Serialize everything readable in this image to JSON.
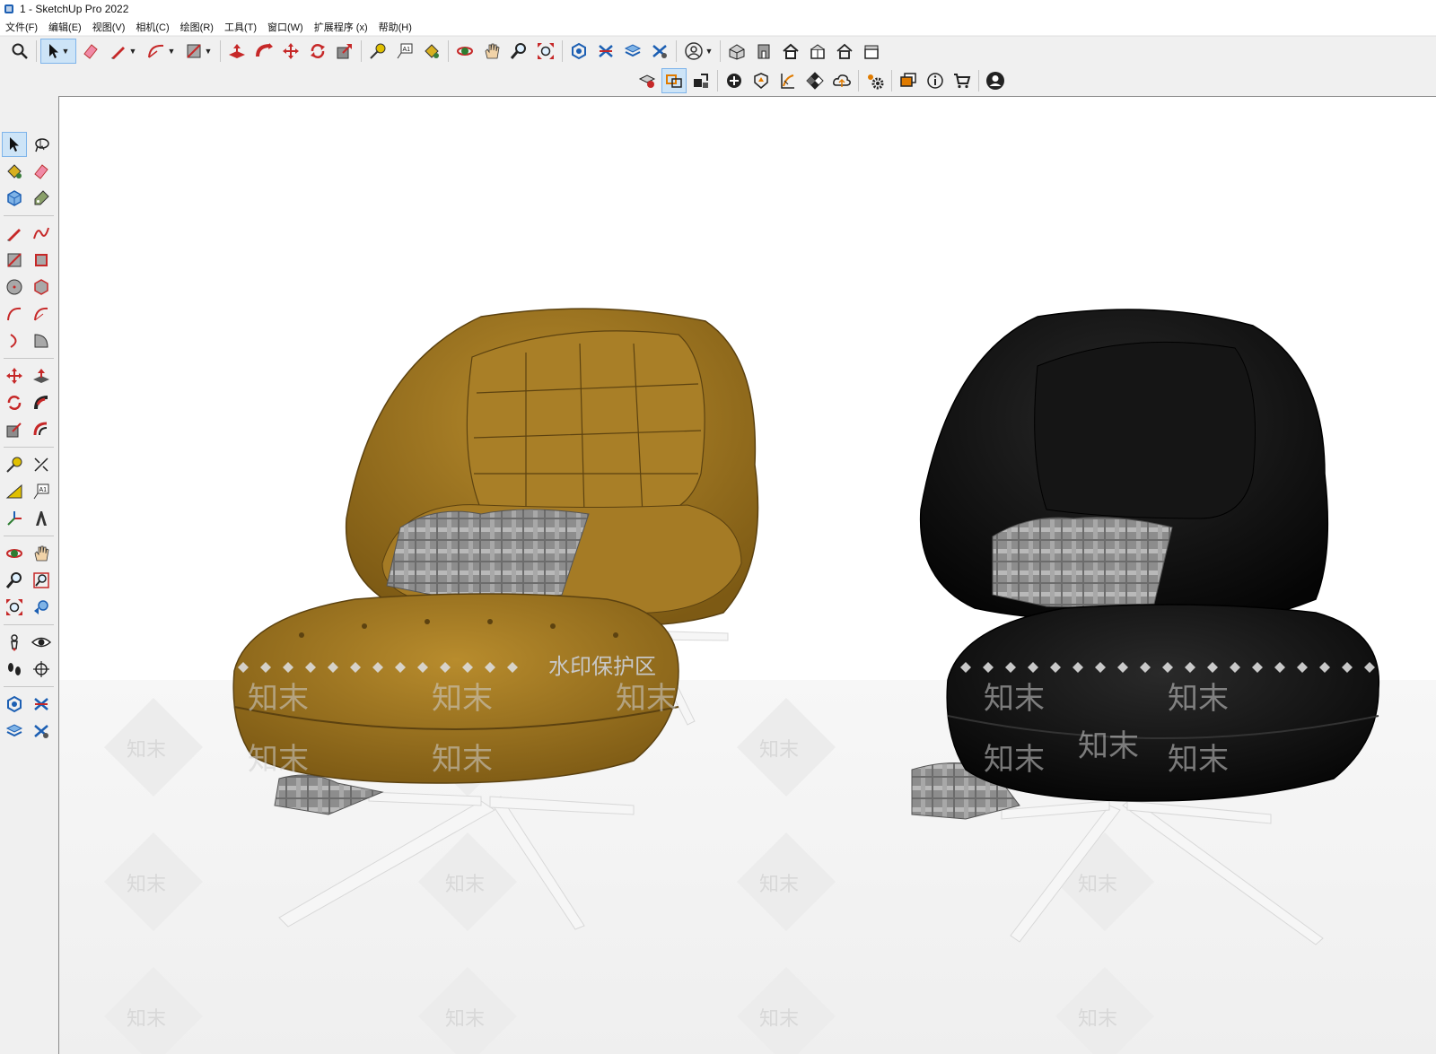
{
  "window": {
    "title": "1 - SketchUp Pro 2022"
  },
  "menu": {
    "items": [
      "文件(F)",
      "编辑(E)",
      "视图(V)",
      "相机(C)",
      "绘图(R)",
      "工具(T)",
      "窗口(W)",
      "扩展程序 (x)",
      "帮助(H)"
    ]
  },
  "watermark": {
    "protect_label": "水印保护区",
    "brand_text": "知末"
  },
  "colors": {
    "accent": "#cde4f7",
    "chair_left": "#a57b25",
    "chair_right": "#1a1a1a",
    "throw": "#8e8e8e",
    "legs": "#f4f4f4"
  },
  "icons": {
    "main_toolbar": [
      "search-icon",
      "select-icon",
      "eraser-icon",
      "pencil-icon",
      "arc-icon",
      "rectangle-icon",
      "push-pull-icon",
      "follow-me-icon",
      "move-icon",
      "rotate-icon",
      "scale-icon",
      "tape-measure-icon",
      "text-icon",
      "paint-bucket-icon",
      "orbit-icon",
      "pan-icon",
      "zoom-icon",
      "zoom-extents-icon",
      "warehouse-icon",
      "extension-warehouse-icon",
      "layout-icon",
      "extension-manager-icon",
      "account-icon",
      "iso-view-icon",
      "front-view-icon",
      "top-view-icon",
      "right-view-icon",
      "back-view-icon",
      "left-view-icon"
    ],
    "secondary_toolbar": [
      "solid-tools-icon",
      "outer-shell-icon",
      "export-icon",
      "add-location-icon",
      "sandbox-icon",
      "styles-icon",
      "textures-icon",
      "cloud-icon",
      "settings-icon",
      "dialog-icon",
      "info-icon",
      "cart-icon",
      "profile-icon"
    ]
  }
}
